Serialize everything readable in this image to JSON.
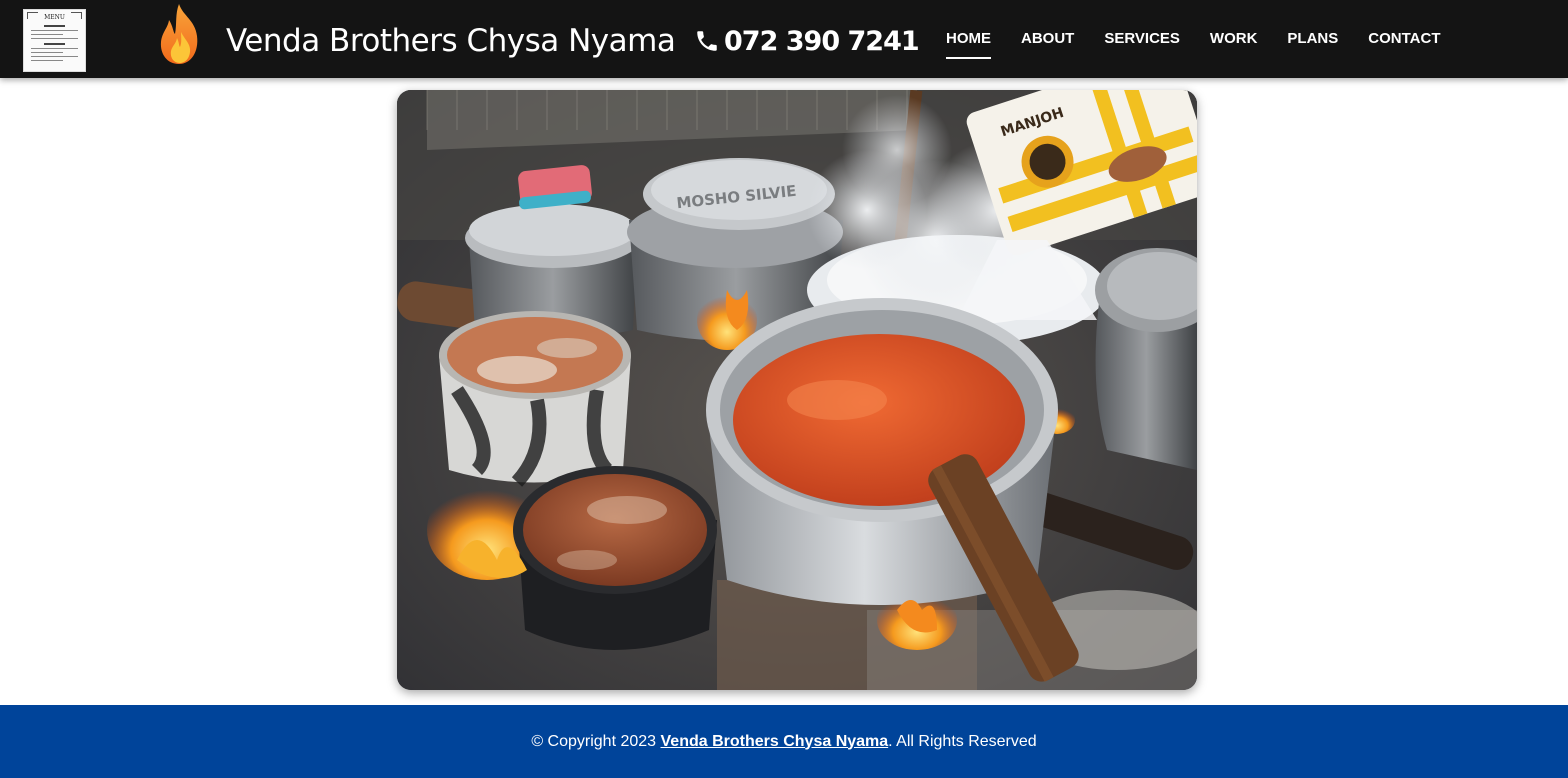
{
  "header": {
    "menu_thumbnail": {
      "title": "MENU",
      "icon": "menu-document-thumbnail"
    },
    "logo_icon": "flame-icon",
    "brand_name": "Venda Brothers Chysa Nyama",
    "phone": {
      "icon": "phone-icon",
      "number": "072 390 7241"
    },
    "nav": [
      {
        "label": "HOME",
        "active": true
      },
      {
        "label": "ABOUT",
        "active": false
      },
      {
        "label": "SERVICES",
        "active": false
      },
      {
        "label": "WORK",
        "active": false
      },
      {
        "label": "PLANS",
        "active": false
      },
      {
        "label": "CONTACT",
        "active": false
      }
    ]
  },
  "hero_image": {
    "alt": "Pots of food cooking over an open wood fire",
    "pot_lettering": "MOSHO SILVIE",
    "bag_lettering": "MANJOH"
  },
  "footer": {
    "copyright_prefix": "© Copyright 2023 ",
    "brand_link": "Venda Brothers Chysa Nyama",
    "copyright_suffix": ". All Rights Reserved"
  },
  "colors": {
    "header_bg": "#141414",
    "footer_bg": "#00449a",
    "text": "#ffffff",
    "flame_orange": "#f58a1f",
    "flame_yellow": "#fcc538"
  }
}
